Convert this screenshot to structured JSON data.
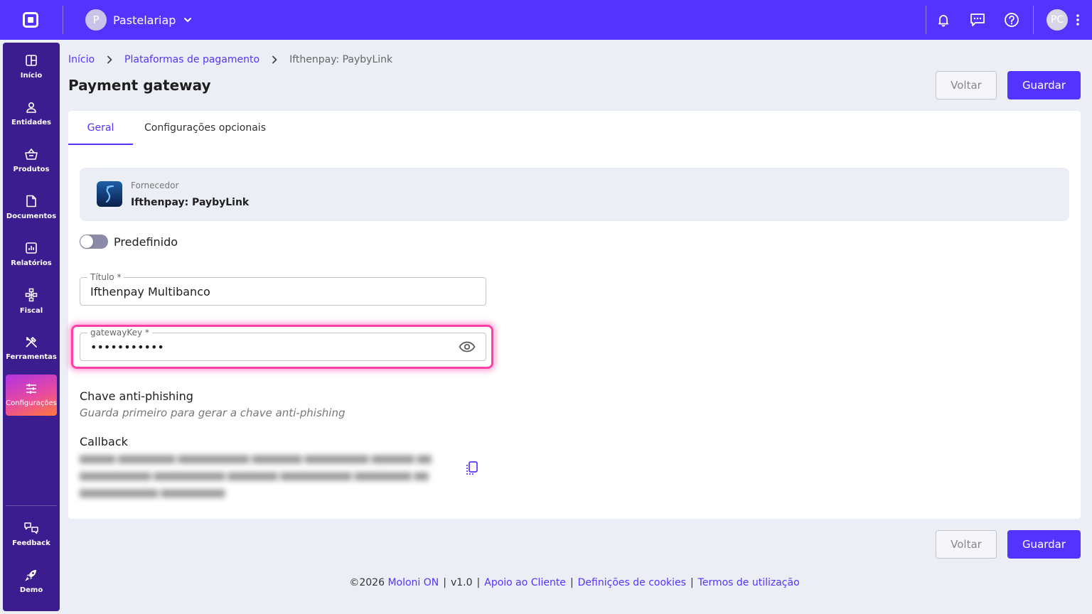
{
  "topbar": {
    "account_initial": "P",
    "account_name": "Pastelariap",
    "user_initials": "PC"
  },
  "sidebar": {
    "items": [
      {
        "label": "Início",
        "icon": "home-grid-icon"
      },
      {
        "label": "Entidades",
        "icon": "person-icon"
      },
      {
        "label": "Produtos",
        "icon": "basket-icon"
      },
      {
        "label": "Documentos",
        "icon": "document-icon"
      },
      {
        "label": "Relatórios",
        "icon": "chart-icon"
      },
      {
        "label": "Fiscal",
        "icon": "fiscal-icon"
      },
      {
        "label": "Ferramentas",
        "icon": "tools-icon"
      },
      {
        "label": "Configurações",
        "icon": "sliders-icon"
      }
    ],
    "bottom_items": [
      {
        "label": "Feedback",
        "icon": "feedback-icon"
      },
      {
        "label": "Demo",
        "icon": "rocket-icon"
      }
    ]
  },
  "breadcrumb": {
    "home": "Início",
    "parent": "Plataformas de pagamento",
    "current": "Ifthenpay: PaybyLink"
  },
  "page": {
    "title": "Payment gateway",
    "back_label": "Voltar",
    "save_label": "Guardar"
  },
  "tabs": {
    "general": "Geral",
    "optional": "Configurações opcionais"
  },
  "provider": {
    "label": "Fornecedor",
    "name": "Ifthenpay: PaybyLink"
  },
  "default_toggle": {
    "label": "Predefinido",
    "on": false
  },
  "fields": {
    "title_label": "Título *",
    "title_value": "Ifthenpay Multibanco",
    "key_label": "gatewayKey *",
    "key_value": "•••••••••••"
  },
  "antiphishing": {
    "title": "Chave anti-phishing",
    "note": "Guarda primeiro para gerar a chave anti-phishing"
  },
  "callback": {
    "title": "Callback"
  },
  "footer": {
    "copyright": "©2026",
    "brand": "Moloni ON",
    "version": "v1.0",
    "support": "Apoio ao Cliente",
    "cookies": "Definições de cookies",
    "terms": "Termos de utilização"
  },
  "colors": {
    "primary": "#5533ff",
    "sidebar": "#3b1d8f",
    "highlight": "#ff3fa8"
  }
}
